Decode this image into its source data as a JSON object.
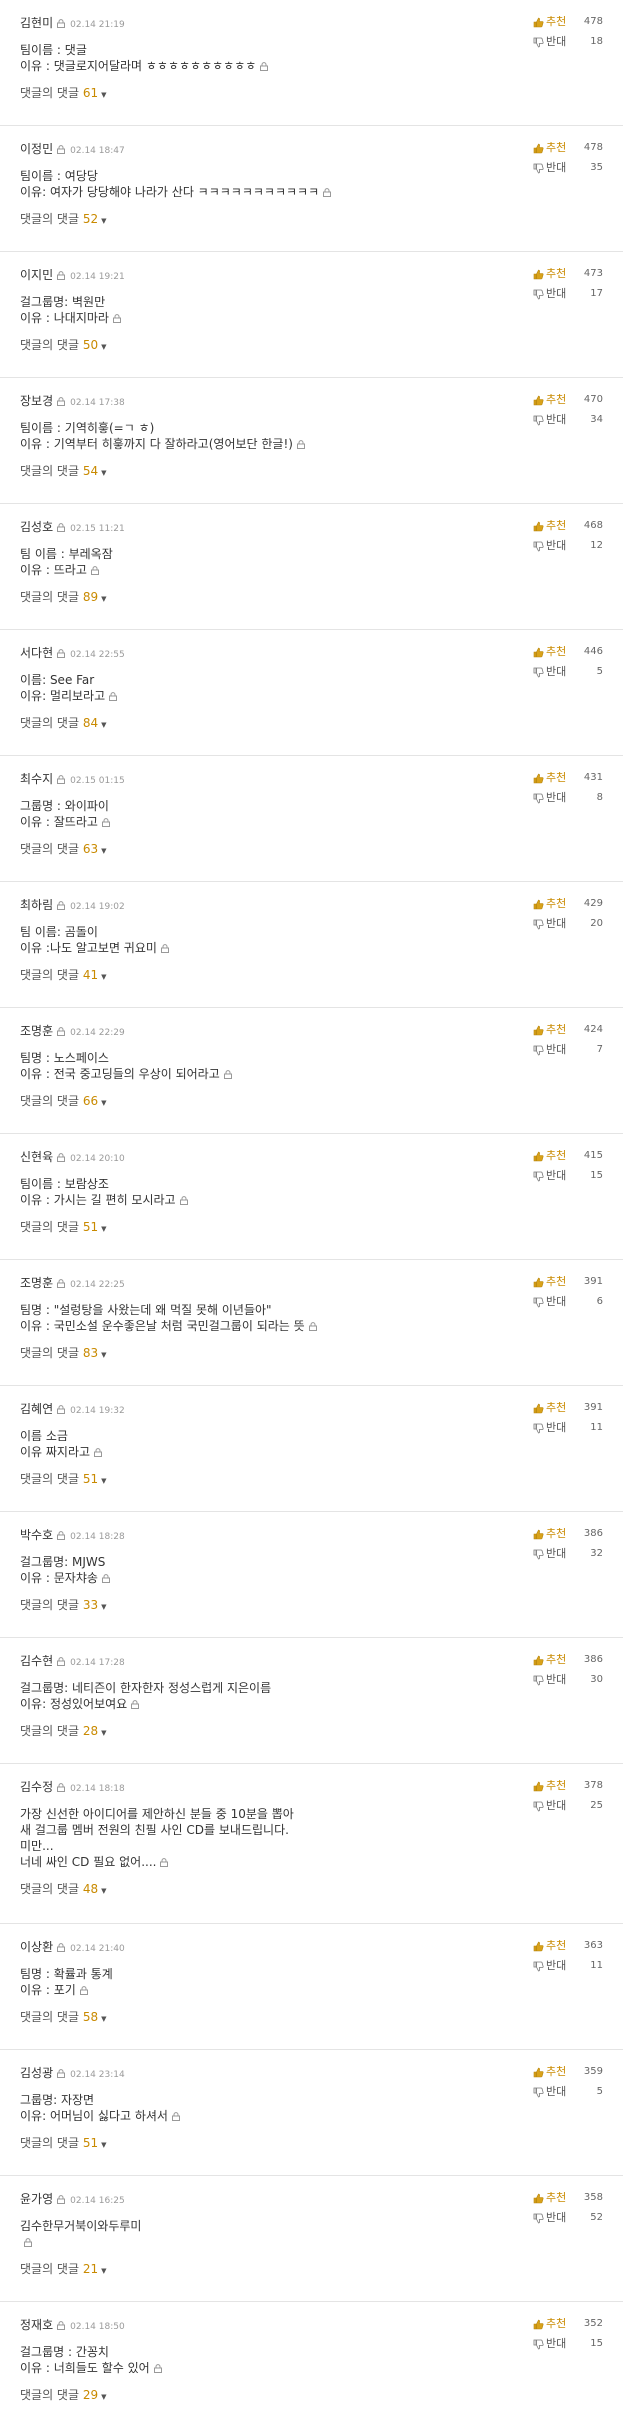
{
  "ui": {
    "upvote_label": "추천",
    "downvote_label": "반대",
    "replies_label": "댓글의 댓글",
    "expand_arrow": "▼",
    "icons": {
      "lock": "lock-icon",
      "thumbs_up": "thumbs-up-icon",
      "thumbs_down": "thumbs-down-icon"
    },
    "colors": {
      "accent": "#c98a00",
      "divider": "#e4e4e4",
      "muted": "#9a9a9a"
    }
  },
  "comments": [
    {
      "author": "김현미",
      "date": "02.14 21:19",
      "lines": [
        "팀이름 : 댓글",
        "이유 : 댓글로지어달라며 ㅎㅎㅎㅎㅎㅎㅎㅎㅎㅎ"
      ],
      "replies": "61",
      "up": "478",
      "down": "18"
    },
    {
      "author": "이정민",
      "date": "02.14 18:47",
      "lines": [
        "팀이름 : 여당당",
        "이유: 여자가 당당해야 나라가 산다 ㅋㅋㅋㅋㅋㅋㅋㅋㅋㅋㅋ"
      ],
      "replies": "52",
      "up": "478",
      "down": "35"
    },
    {
      "author": "이지민",
      "date": "02.14 19:21",
      "lines": [
        "걸그룹명: 벽원만",
        "이유 : 나대지마라"
      ],
      "replies": "50",
      "up": "473",
      "down": "17"
    },
    {
      "author": "장보경",
      "date": "02.14 17:38",
      "lines": [
        "팀이름 : 기역히흫(=ㄱ ㅎ)",
        "이유 : 기역부터 히흫까지 다 잘하라고(영어보단 한글!)"
      ],
      "replies": "54",
      "up": "470",
      "down": "34"
    },
    {
      "author": "김성호",
      "date": "02.15 11:21",
      "lines": [
        "팀 이름 : 부레옥잠",
        "이유 : 뜨라고"
      ],
      "replies": "89",
      "up": "468",
      "down": "12"
    },
    {
      "author": "서다현",
      "date": "02.14 22:55",
      "lines": [
        "이름: See Far",
        "이유: 멀리보라고"
      ],
      "replies": "84",
      "up": "446",
      "down": "5"
    },
    {
      "author": "최수지",
      "date": "02.15 01:15",
      "lines": [
        "그룹명 : 와이파이",
        "이유 : 잘뜨라고"
      ],
      "replies": "63",
      "up": "431",
      "down": "8"
    },
    {
      "author": "최하림",
      "date": "02.14 19:02",
      "lines": [
        "팀 이름: 곰돌이",
        "이유 :나도 알고보면 귀요미"
      ],
      "replies": "41",
      "up": "429",
      "down": "20"
    },
    {
      "author": "조명훈",
      "date": "02.14 22:29",
      "lines": [
        "팀명 : 노스페이스",
        "이유 : 전국 중고딩들의 우상이 되어라고"
      ],
      "replies": "66",
      "up": "424",
      "down": "7"
    },
    {
      "author": "신현육",
      "date": "02.14 20:10",
      "lines": [
        "팀이름 : 보람상조",
        "이유 : 가시는 길 편히 모시라고"
      ],
      "replies": "51",
      "up": "415",
      "down": "15"
    },
    {
      "author": "조명훈",
      "date": "02.14 22:25",
      "lines": [
        "팀명 : \"설렁탕을 사왔는데 왜 먹질 못해 이년들아\"",
        "이유 : 국민소설 운수좋은날 처럼 국민걸그룹이 되라는 뜻"
      ],
      "replies": "83",
      "up": "391",
      "down": "6"
    },
    {
      "author": "김혜연",
      "date": "02.14 19:32",
      "lines": [
        "이름 소금",
        "이유 짜지라고"
      ],
      "replies": "51",
      "up": "391",
      "down": "11"
    },
    {
      "author": "박수호",
      "date": "02.14 18:28",
      "lines": [
        "걸그룹명: MJWS",
        "이유 : 문자챠송"
      ],
      "replies": "33",
      "up": "386",
      "down": "32"
    },
    {
      "author": "김수현",
      "date": "02.14 17:28",
      "lines": [
        "걸그룹명: 네티즌이 한자한자 정성스럽게 지은이름",
        "이유: 정성있어보여요"
      ],
      "replies": "28",
      "up": "386",
      "down": "30"
    },
    {
      "author": "김수정",
      "date": "02.14 18:18",
      "lines": [
        "가장 신선한 아이디어를 제안하신 분들 중 10분을 뽑아",
        "새 걸그룹 멤버 전원의 친필 사인 CD를 보내드립니다.",
        "미만...",
        "너네 싸인 CD 필요 없어...."
      ],
      "replies": "48",
      "up": "378",
      "down": "25"
    },
    {
      "author": "이상환",
      "date": "02.14 21:40",
      "lines": [
        "팀명 : 확률과 통계",
        "이유 : 포기"
      ],
      "replies": "58",
      "up": "363",
      "down": "11"
    },
    {
      "author": "김성광",
      "date": "02.14 23:14",
      "lines": [
        "그룹명: 자장면",
        "이유: 어머님이 싫다고 하셔서"
      ],
      "replies": "51",
      "up": "359",
      "down": "5"
    },
    {
      "author": "윤가영",
      "date": "02.14 16:25",
      "lines": [
        "김수한무거북이와두루미",
        ""
      ],
      "replies": "21",
      "up": "358",
      "down": "52"
    },
    {
      "author": "정재호",
      "date": "02.14 18:50",
      "lines": [
        "걸그룹명 : 간꽁치",
        "이유 : 너희들도 할수 있어"
      ],
      "replies": "29",
      "up": "352",
      "down": "15"
    }
  ]
}
